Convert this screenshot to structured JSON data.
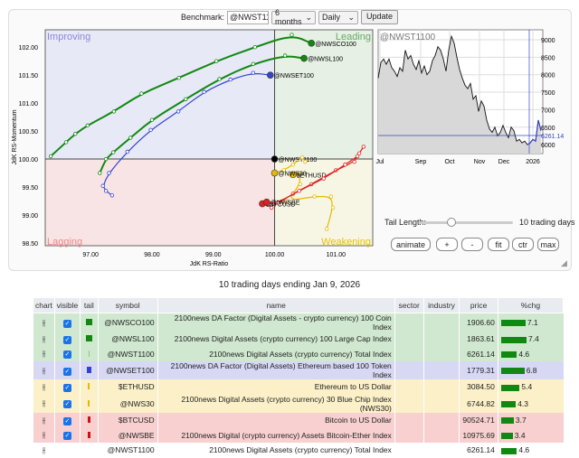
{
  "benchmark": {
    "label": "Benchmark:",
    "value": "@NWST1100",
    "period": "6 months",
    "frequency": "Daily",
    "update": "Update"
  },
  "rrg": {
    "quadrants": {
      "improving": "Improving",
      "leading": "Leading",
      "lagging": "Lagging",
      "weakening": "Weakening"
    },
    "xlabel": "JdK RS-Ratio",
    "ylabel": "JdK RS-Momentum",
    "xticks": [
      "97.00",
      "98.00",
      "99.00",
      "100.00",
      "101.00"
    ],
    "yticks": [
      "102.00",
      "101.50",
      "101.00",
      "100.50",
      "100.00",
      "99.50",
      "99.00",
      "98.50"
    ]
  },
  "chart_data": {
    "type": "scatter",
    "xlim": [
      96.26,
      101.6
    ],
    "ylim": [
      98.45,
      102.31
    ],
    "series": [
      {
        "name": "@NWSCO100",
        "color": "#118811",
        "tail": [
          [
            96.35,
            100.05
          ],
          [
            96.6,
            100.3
          ],
          [
            96.75,
            100.45
          ],
          [
            96.95,
            100.6
          ],
          [
            97.38,
            100.85
          ],
          [
            97.83,
            101.17
          ],
          [
            98.44,
            101.45
          ],
          [
            99.05,
            101.75
          ],
          [
            99.68,
            102.0
          ],
          [
            100.28,
            102.22
          ],
          [
            100.6,
            102.07
          ]
        ]
      },
      {
        "name": "@NWSL100",
        "color": "#118811",
        "tail": [
          [
            97.15,
            99.75
          ],
          [
            97.25,
            100.0
          ],
          [
            97.37,
            100.12
          ],
          [
            97.65,
            100.38
          ],
          [
            98.0,
            100.7
          ],
          [
            98.55,
            101.07
          ],
          [
            99.1,
            101.43
          ],
          [
            99.65,
            101.7
          ],
          [
            100.17,
            101.85
          ],
          [
            100.48,
            101.8
          ]
        ]
      },
      {
        "name": "@NWSET100",
        "color": "#3344cc",
        "tail": [
          [
            97.35,
            99.35
          ],
          [
            97.25,
            99.43
          ],
          [
            97.2,
            99.52
          ],
          [
            97.3,
            99.75
          ],
          [
            97.6,
            100.13
          ],
          [
            97.98,
            100.52
          ],
          [
            98.43,
            100.85
          ],
          [
            98.85,
            101.2
          ],
          [
            99.28,
            101.42
          ],
          [
            99.65,
            101.54
          ],
          [
            99.93,
            101.5
          ]
        ]
      },
      {
        "name": "@NWST1100",
        "color": "#000000",
        "tail": [
          [
            100,
            100
          ]
        ]
      },
      {
        "name": "$ETHUSD",
        "color": "#e8b800",
        "tail": [
          [
            100.85,
            98.75
          ],
          [
            100.95,
            99.13
          ],
          [
            100.92,
            99.33
          ],
          [
            100.65,
            99.33
          ],
          [
            100.2,
            99.25
          ],
          [
            100.42,
            99.55
          ],
          [
            100.4,
            99.75
          ],
          [
            100.3,
            99.72
          ]
        ]
      },
      {
        "name": "@NWS30",
        "color": "#e8b800",
        "tail": [
          [
            100.5,
            99.95
          ],
          [
            100.45,
            100.03
          ],
          [
            100.3,
            99.9
          ],
          [
            100.15,
            99.8
          ],
          [
            100.0,
            99.75
          ]
        ]
      },
      {
        "name": "$BTCUSD",
        "color": "#dd2222",
        "tail": [
          [
            101.45,
            100.22
          ],
          [
            101.38,
            100.1
          ],
          [
            101.3,
            99.95
          ],
          [
            101.0,
            99.8
          ],
          [
            100.6,
            99.55
          ],
          [
            100.3,
            99.38
          ],
          [
            99.95,
            99.13
          ],
          [
            99.8,
            99.2
          ]
        ]
      },
      {
        "name": "@NWSBE",
        "color": "#dd2222",
        "tail": [
          [
            101.35,
            100.05
          ],
          [
            101.15,
            99.9
          ],
          [
            100.8,
            99.65
          ],
          [
            100.4,
            99.43
          ],
          [
            100.05,
            99.22
          ],
          [
            99.87,
            99.23
          ]
        ]
      }
    ]
  },
  "price_chart": {
    "title": "@NWST1100",
    "last": "6261.14",
    "lastValue": 6261.14,
    "yticks": [
      "9000",
      "8500",
      "8000",
      "7500",
      "7000",
      "6500",
      "6000"
    ],
    "xticks": [
      "Jul",
      "Sep",
      "Oct",
      "Nov",
      "Dec",
      "2026"
    ],
    "values": [
      7900,
      8350,
      8450,
      8300,
      8450,
      8200,
      8100,
      7950,
      8200,
      8100,
      8700,
      8450,
      8550,
      8300,
      8150,
      8400,
      8050,
      8250,
      8000,
      8100,
      8400,
      8550,
      8800,
      8700,
      8450,
      8100,
      8700,
      9100,
      8900,
      8500,
      8150,
      7900,
      7700,
      7600,
      7750,
      7300,
      7400,
      6950,
      7250,
      7100,
      6700,
      6450,
      6350,
      6500,
      6250,
      6350,
      6550,
      6350,
      6200,
      6500,
      6400,
      6100,
      6150,
      6050,
      6100,
      6000,
      6050,
      6150,
      6100,
      6700,
      6400
    ]
  },
  "tail": {
    "label": "Tail Length:",
    "value": "10 trading days",
    "fraction": 0.3
  },
  "buttons": [
    "animate",
    "+",
    "-",
    "fit",
    "ctr",
    "max"
  ],
  "table": {
    "title": "10 trading days ending Jan 9, 2026",
    "headers": [
      "chart",
      "visible",
      "tail",
      "symbol",
      "name",
      "sector",
      "industry",
      "price",
      "%chg"
    ],
    "rows": [
      {
        "symbol": "@NWSCO100",
        "name": "2100news DA Factor (Digital Assets - crypto currency) 100 Coin Index",
        "price": "1906.60",
        "chg": "7.1",
        "bg": "#cfe8cf",
        "tail": "#118811",
        "tw": 7,
        "visible": true
      },
      {
        "symbol": "@NWSL100",
        "name": "2100news Digital Assets (crypto currency) 100 Large Cap Index",
        "price": "1863.61",
        "chg": "7.4",
        "bg": "#cfe8cf",
        "tail": "#118811",
        "tw": 7,
        "visible": true
      },
      {
        "symbol": "@NWST1100",
        "name": "2100news Digital Assets (crypto currency) Total Index",
        "price": "6261.14",
        "chg": "4.6",
        "bg": "#cfe8cf",
        "tail": "#88cc88",
        "tw": 1,
        "visible": true
      },
      {
        "symbol": "@NWSET100",
        "name": "2100news DA Factor (Digital Assets) Ethereum based 100 Token Index",
        "price": "1779.31",
        "chg": "6.8",
        "bg": "#d6d8f4",
        "tail": "#3344cc",
        "tw": 5,
        "visible": true
      },
      {
        "symbol": "$ETHUSD",
        "name": "Ethereum to US Dollar",
        "price": "3084.50",
        "chg": "5.4",
        "bg": "#fbf0c8",
        "tail": "#e8b800",
        "tw": 2,
        "visible": true
      },
      {
        "symbol": "@NWS30",
        "name": "2100news Digital Assets (crypto currency) 30 Blue Chip Index (NWS30)",
        "price": "6744.82",
        "chg": "4.3",
        "bg": "#fbf0c8",
        "tail": "#e8b800",
        "tw": 2,
        "visible": true
      },
      {
        "symbol": "$BTCUSD",
        "name": "Bitcoin to US Dollar",
        "price": "90524.71",
        "chg": "3.7",
        "bg": "#f8d0d0",
        "tail": "#cc1111",
        "tw": 3,
        "visible": true
      },
      {
        "symbol": "@NWSBE",
        "name": "2100news Digital (crypto currency) Assets Bitcoin-Ether Index",
        "price": "10975.69",
        "chg": "3.4",
        "bg": "#f8d0d0",
        "tail": "#cc1111",
        "tw": 3,
        "visible": true
      },
      {
        "symbol": "@NWST1100",
        "name": "2100news Digital Assets (crypto currency) Total Index",
        "price": "6261.14",
        "chg": "4.6",
        "bg": "#ffffff",
        "tail": "",
        "tw": 0,
        "visible": false
      }
    ]
  }
}
